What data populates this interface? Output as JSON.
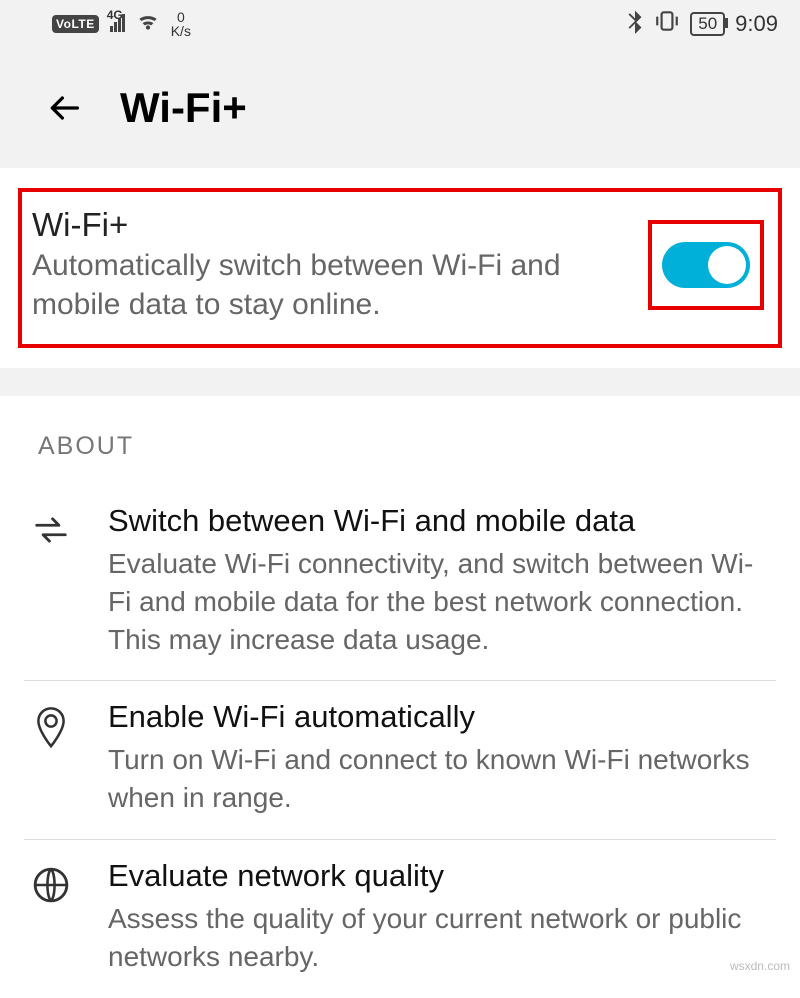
{
  "statusbar": {
    "volte": "VoLTE",
    "net_label": "4G",
    "speed_top": "0",
    "speed_unit": "K/s",
    "battery": "50",
    "time": "9:09"
  },
  "header": {
    "title": "Wi-Fi+"
  },
  "main_toggle": {
    "title": "Wi-Fi+",
    "description": "Automatically switch between Wi-Fi and mobile data to stay online.",
    "on": true
  },
  "about": {
    "label": "ABOUT",
    "items": [
      {
        "icon": "swap",
        "title": "Switch between Wi-Fi and mobile data",
        "description": "Evaluate Wi-Fi connectivity, and switch between Wi-Fi and mobile data for the best network connection. This may increase data usage."
      },
      {
        "icon": "pin",
        "title": "Enable Wi-Fi automatically",
        "description": "Turn on Wi-Fi and connect to known Wi-Fi networks when in range."
      },
      {
        "icon": "globe",
        "title": "Evaluate network quality",
        "description": "Assess the quality of your current network or public networks nearby."
      }
    ]
  },
  "watermark": "wsxdn.com"
}
